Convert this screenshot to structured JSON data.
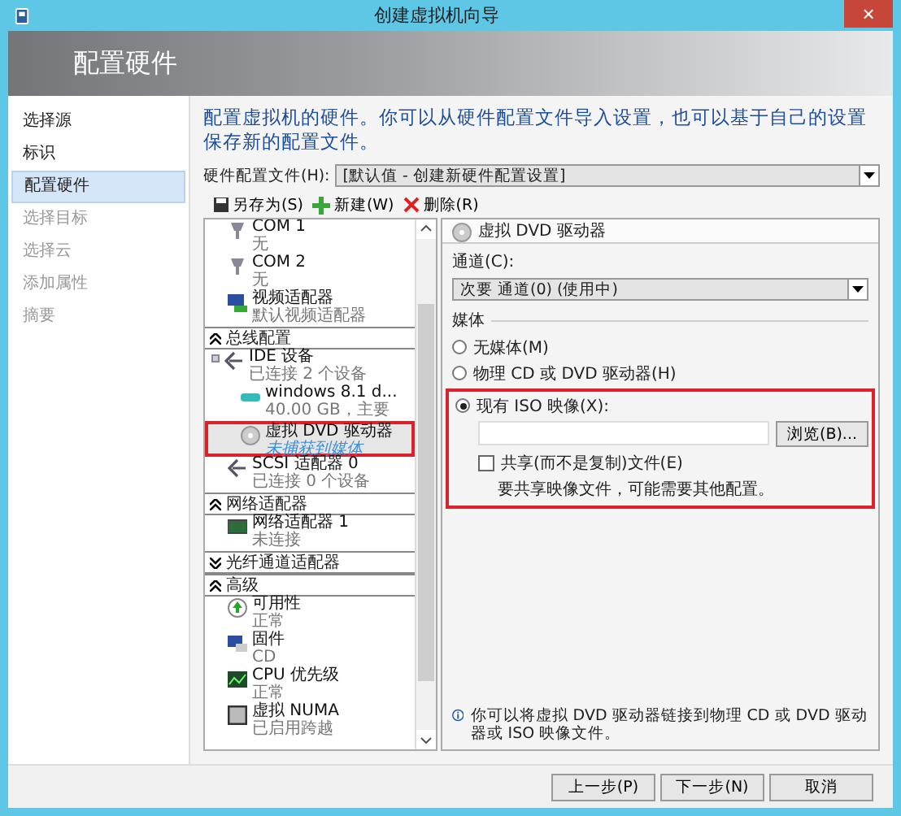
{
  "window": {
    "title": "创建虚拟机向导",
    "close": "×"
  },
  "header": {
    "title": "配置硬件"
  },
  "nav": [
    {
      "label": "选择源",
      "selected": false,
      "disabled": false
    },
    {
      "label": "标识",
      "selected": false,
      "disabled": false
    },
    {
      "label": "配置硬件",
      "selected": true,
      "disabled": false
    },
    {
      "label": "选择目标",
      "selected": false,
      "disabled": true
    },
    {
      "label": "选择云",
      "selected": false,
      "disabled": true
    },
    {
      "label": "添加属性",
      "selected": false,
      "disabled": true
    },
    {
      "label": "摘要",
      "selected": false,
      "disabled": true
    }
  ],
  "description": "配置虚拟机的硬件。你可以从硬件配置文件导入设置，也可以基于自己的设置保存新的配置文件。",
  "profile": {
    "label": "硬件配置文件(H):",
    "value": "[默认值 - 创建新硬件配置设置]"
  },
  "toolbar": [
    {
      "kind": "save",
      "label": "另存为(S)"
    },
    {
      "kind": "new",
      "label": "新建(W)"
    },
    {
      "kind": "delete",
      "label": "删除(R)"
    }
  ],
  "tree": [
    {
      "kind": "port",
      "name": "COM 1",
      "detail": "无",
      "selected": false
    },
    {
      "kind": "port",
      "name": "COM 2",
      "detail": "无",
      "selected": false
    },
    {
      "kind": "display",
      "name": "视频适配器",
      "detail": "默认视频适配器",
      "selected": false
    },
    {
      "kind": "section",
      "label": "总线配置",
      "expanded": true,
      "children": [
        {
          "kind": "bus",
          "name": "IDE 设备",
          "detail": "已连接 2 个设备",
          "selected": false,
          "children": [
            {
              "kind": "disk",
              "name": "windows 8.1 d...",
              "detail": "40.00 GB，主要",
              "selected": false
            },
            {
              "kind": "dvd",
              "name": "虚拟 DVD 驱动器",
              "detail": "未捕获到媒体",
              "selected": true
            }
          ]
        },
        {
          "kind": "bus",
          "name": "SCSI 适配器 0",
          "detail": "已连接 0 个设备",
          "selected": false
        }
      ]
    },
    {
      "kind": "section",
      "label": "网络适配器",
      "expanded": true,
      "children": [
        {
          "kind": "network",
          "name": "网络适配器 1",
          "detail": "未连接",
          "selected": false
        }
      ]
    },
    {
      "kind": "section",
      "label": "光纤通道适配器",
      "expanded": false
    },
    {
      "kind": "section",
      "label": "高级",
      "expanded": true,
      "children": [
        {
          "kind": "availability",
          "name": "可用性",
          "detail": "正常",
          "selected": false
        },
        {
          "kind": "firmware",
          "name": "固件",
          "detail": "CD",
          "selected": false
        },
        {
          "kind": "cpu",
          "name": "CPU 优先级",
          "detail": "正常",
          "selected": false
        },
        {
          "kind": "numa",
          "name": "虚拟 NUMA",
          "detail": "已启用跨越",
          "selected": false
        }
      ]
    }
  ],
  "detail": {
    "title": "虚拟 DVD 驱动器",
    "channel_label": "通道(C):",
    "channel_value": "次要 通道(0) (使用中)",
    "media_label": "媒体",
    "media": [
      {
        "label": "无媒体(M)",
        "selected": false
      },
      {
        "label": "物理 CD 或 DVD 驱动器(H)",
        "selected": false
      },
      {
        "label": "现有 ISO 映像(X):",
        "selected": true
      }
    ],
    "iso_highlighted": true,
    "browse": "浏览(B)...",
    "share": {
      "label": "共享(而不是复制)文件(E)",
      "checked": false
    },
    "share_note": "要共享映像文件，可能需要其他配置。",
    "info": "你可以将虚拟 DVD 驱动器链接到物理 CD 或 DVD 驱动器或 ISO 映像文件。"
  },
  "buttons": [
    {
      "label": "上一步(P)"
    },
    {
      "label": "下一步(N)"
    },
    {
      "label": "取消"
    }
  ]
}
